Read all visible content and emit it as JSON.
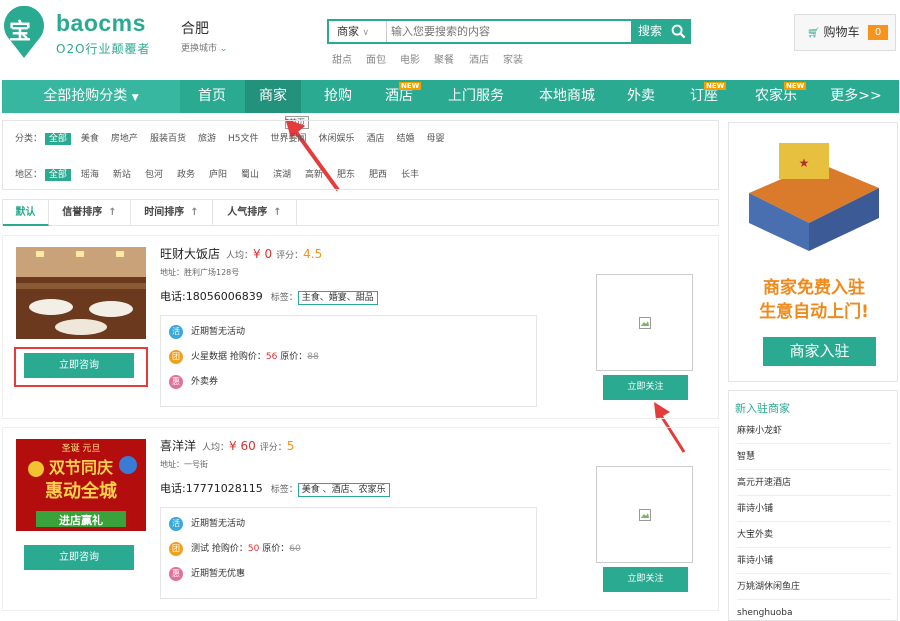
{
  "header": {
    "logo_char": "宝",
    "logo_text": "baocms",
    "slogan": "O2O行业颠覆者",
    "city": "合肥",
    "city_change": "更换城市",
    "search_type": "商家",
    "search_placeholder": "输入您要搜索的内容",
    "search_button": "搜索",
    "hot_words": [
      "甜点",
      "面包",
      "电影",
      "聚餐",
      "酒店",
      "家装"
    ],
    "cart_label": "购物车",
    "cart_count": "0"
  },
  "nav": {
    "all_label": "全部抢购分类",
    "items": [
      {
        "label": "首页",
        "new": false
      },
      {
        "label": "商家",
        "new": false
      },
      {
        "label": "抢购",
        "new": false
      },
      {
        "label": "酒店",
        "new": true
      },
      {
        "label": "上门服务",
        "new": false
      },
      {
        "label": "本地商城",
        "new": false
      },
      {
        "label": "外卖",
        "new": false
      },
      {
        "label": "订座",
        "new": true
      },
      {
        "label": "农家乐",
        "new": true
      },
      {
        "label": "更多>>",
        "new": false
      }
    ],
    "new_text": "NEW",
    "tooltip": "首页"
  },
  "filter": {
    "category_label": "分类：",
    "categories": [
      "全部",
      "美食",
      "房地产",
      "服装百货",
      "旅游",
      "H5文件",
      "世界要闻",
      "休闲娱乐",
      "酒店",
      "结婚",
      "母婴"
    ],
    "area_label": "地区：",
    "areas": [
      "全部",
      "瑶海",
      "新站",
      "包河",
      "政务",
      "庐阳",
      "蜀山",
      "滨湖",
      "高新",
      "肥东",
      "肥西",
      "长丰"
    ]
  },
  "sort": {
    "items": [
      "默认",
      "信誉排序",
      "时间排序",
      "人气排序"
    ],
    "arrow": "↑"
  },
  "shops": [
    {
      "name": "旺财大饭店",
      "avg_label": "人均：",
      "avg_price": "¥ 0",
      "score_label": "评分：",
      "score": "4.5",
      "address": "地址：胜利广场128号",
      "tel": "电话:18056006839",
      "tag_label": "标签：",
      "tags": "主食、婚宴、甜品",
      "consult": "立即咨询",
      "follow": "立即关注",
      "promos": [
        {
          "icon": "活",
          "text": "近期暂无活动",
          "price_label": "",
          "price": "",
          "orig_label": "",
          "orig": ""
        },
        {
          "icon": "团",
          "text": "火星数据",
          "price_label": " 抢购价：",
          "price": "56",
          "orig_label": " 原价：",
          "orig": "88"
        },
        {
          "icon": "惠",
          "text": "外卖券",
          "price_label": "",
          "price": "",
          "orig_label": "",
          "orig": ""
        }
      ]
    },
    {
      "name": "喜洋洋",
      "avg_label": "人均：",
      "avg_price": "¥ 60",
      "score_label": "评分：",
      "score": "5",
      "address": "地址：一号街",
      "tel": "电话:17771028115",
      "tag_label": "标签：",
      "tags": "美食 、酒店、农家乐",
      "consult": "立即咨询",
      "follow": "立即关注",
      "promos": [
        {
          "icon": "活",
          "text": "近期暂无活动",
          "price_label": "",
          "price": "",
          "orig_label": "",
          "orig": ""
        },
        {
          "icon": "团",
          "text": "测试",
          "price_label": " 抢购价：",
          "price": "50",
          "orig_label": " 原价：",
          "orig": "60"
        },
        {
          "icon": "惠",
          "text": "近期暂无优惠",
          "price_label": "",
          "price": "",
          "orig_label": "",
          "orig": ""
        }
      ]
    }
  ],
  "banner_image_text": [
    "圣诞 元旦",
    "双节同庆",
    "惠动全城",
    "进店赢礼"
  ],
  "ad": {
    "line1": "商家免费入驻",
    "line2": "生意自动上门!",
    "button": "商家入驻"
  },
  "new_shops": {
    "title": "新入驻商家",
    "items": [
      "麻辣小龙虾",
      "智慧",
      "高元开速酒店",
      "菲诗小铺",
      "大宝外卖",
      "菲诗小铺",
      "万姚湖休闲鱼庄",
      "shenghuoba"
    ]
  },
  "colors": {
    "brand": "#2aaa91",
    "alert": "#e63b3b",
    "price": "#e02d2d"
  }
}
